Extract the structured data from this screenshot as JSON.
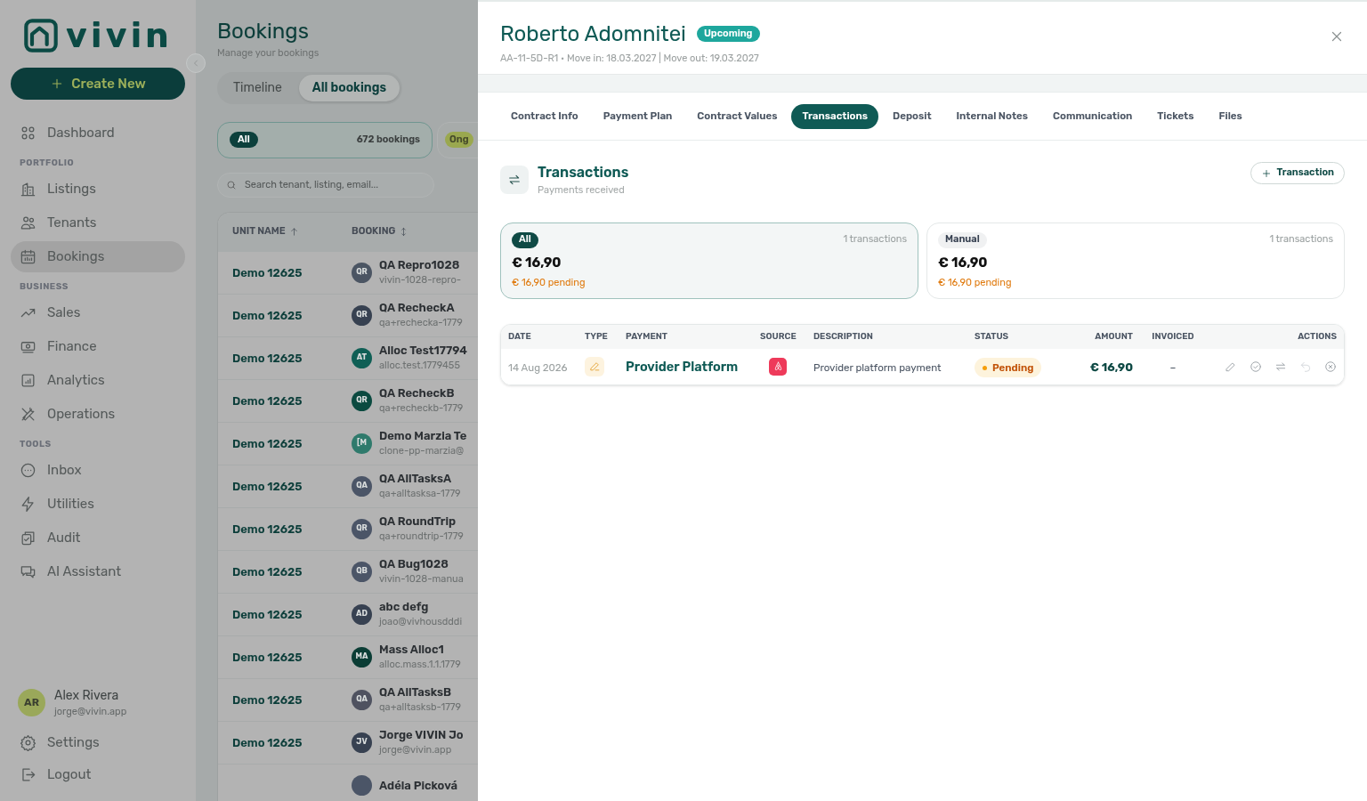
{
  "sidebar": {
    "logo": "vivin",
    "create_button": "Create New",
    "sections": [
      {
        "items": [
          {
            "label": "Dashboard",
            "selected": false
          }
        ]
      },
      {
        "heading": "PORTFOLIO",
        "items": [
          {
            "label": "Listings",
            "selected": false
          },
          {
            "label": "Tenants",
            "selected": false
          },
          {
            "label": "Bookings",
            "selected": true
          }
        ]
      },
      {
        "heading": "BUSINESS",
        "items": [
          {
            "label": "Sales",
            "selected": false
          },
          {
            "label": "Finance",
            "selected": false
          },
          {
            "label": "Analytics",
            "selected": false
          },
          {
            "label": "Operations",
            "selected": false
          }
        ]
      },
      {
        "heading": "TOOLS",
        "items": [
          {
            "label": "Inbox",
            "selected": false
          },
          {
            "label": "Utilities",
            "selected": false
          },
          {
            "label": "Audit",
            "selected": false
          },
          {
            "label": "AI Assistant",
            "selected": false
          }
        ]
      }
    ],
    "user": {
      "initials": "AR",
      "name": "Alex Rivera",
      "email": "jorge@vivin.app"
    },
    "footer": [
      "Settings",
      "Logout"
    ]
  },
  "main": {
    "title": "Bookings",
    "subtitle": "Manage your bookings",
    "view_tabs": [
      {
        "label": "Timeline",
        "selected": false
      },
      {
        "label": "All bookings",
        "selected": true
      }
    ],
    "filter_chips": [
      {
        "label": "All",
        "count": "672 bookings",
        "selected": true
      },
      {
        "label": "Ong",
        "selected": false
      }
    ],
    "search": {
      "placeholder": "Search tenant, listing, email..."
    },
    "table": {
      "columns": [
        "UNIT NAME",
        "BOOKING"
      ],
      "rows": [
        {
          "unit": "Demo 12625",
          "initials": "QR",
          "color": "#4b5563",
          "name": "QA Repro1028",
          "email": "vivin-1028-repro-"
        },
        {
          "unit": "Demo 12625",
          "initials": "QR",
          "color": "#374151",
          "name": "QA RecheckA",
          "email": "qa+rechecka-1779"
        },
        {
          "unit": "Demo 12625",
          "initials": "AT",
          "color": "#0f5f55",
          "name": "Alloc Test17794",
          "email": "alloc.test.1779455"
        },
        {
          "unit": "Demo 12625",
          "initials": "QR",
          "color": "#0b4a40",
          "name": "QA RecheckB",
          "email": "qa+recheckb-1779"
        },
        {
          "unit": "Demo 12625",
          "initials": "[M",
          "color": "#2f7a6c",
          "name": "Demo Marzia Te",
          "email": "clone-pp-marzia@"
        },
        {
          "unit": "Demo 12625",
          "initials": "QA",
          "color": "#4b5567",
          "name": "QA AllTasksA",
          "email": "qa+alltasksa-1779"
        },
        {
          "unit": "Demo 12625",
          "initials": "QR",
          "color": "#4b5567",
          "name": "QA RoundTrip",
          "email": "qa+roundtrip-1779"
        },
        {
          "unit": "Demo 12625",
          "initials": "QB",
          "color": "#4b5567",
          "name": "QA Bug1028",
          "email": "vivin-1028-manua"
        },
        {
          "unit": "Demo 12625",
          "initials": "AD",
          "color": "#374151",
          "name": "abc defg",
          "email": "joao@vivhousdddi"
        },
        {
          "unit": "Demo 12625",
          "initials": "MA",
          "color": "#0b3d35",
          "name": "Mass Alloc1",
          "email": "alloc.mass.1.1.1779"
        },
        {
          "unit": "Demo 12625",
          "initials": "QA",
          "color": "#4f5260",
          "name": "QA AllTasksB",
          "email": "qa+alltasksb-1779"
        },
        {
          "unit": "Demo 12625",
          "initials": "JV",
          "color": "#374151",
          "name": "Jorge VIVIN Jo",
          "email": "jorge@vivin.app"
        },
        {
          "color": "#4b5567",
          "name": "Adéla Picková"
        }
      ]
    }
  },
  "drawer": {
    "name": "Roberto Adomnitei",
    "badge": "Upcoming",
    "meta": "AA-11-5D-R1 • Move in: 18.03.2027 | Move out: 19.03.2027",
    "tabs": [
      {
        "label": "Contract Info",
        "selected": false
      },
      {
        "label": "Payment Plan",
        "selected": false
      },
      {
        "label": "Contract Values",
        "selected": false
      },
      {
        "label": "Transactions",
        "selected": true
      },
      {
        "label": "Deposit",
        "selected": false
      },
      {
        "label": "Internal Notes",
        "selected": false
      },
      {
        "label": "Communication",
        "selected": false
      },
      {
        "label": "Tickets",
        "selected": false
      },
      {
        "label": "Files",
        "selected": false
      }
    ],
    "section": {
      "title": "Transactions",
      "subtitle": "Payments received",
      "add_button": "Transaction"
    },
    "summary_cards": [
      {
        "label": "All",
        "count": "1 transactions",
        "amount": "€ 16,90",
        "pending": "€ 16,90 pending",
        "selected": true
      },
      {
        "label": "Manual",
        "count": "1 transactions",
        "amount": "€ 16,90",
        "pending": "€ 16,90 pending",
        "selected": false
      }
    ],
    "table": {
      "columns": [
        "DATE",
        "TYPE",
        "PAYMENT",
        "SOURCE",
        "DESCRIPTION",
        "STATUS",
        "AMOUNT",
        "INVOICED",
        "ACTIONS"
      ],
      "rows": [
        {
          "date": "14 Aug 2026",
          "payment": "Provider Platform",
          "description": "Provider platform payment",
          "status": "Pending",
          "amount": "€ 16,90",
          "invoiced": "–"
        }
      ]
    }
  }
}
